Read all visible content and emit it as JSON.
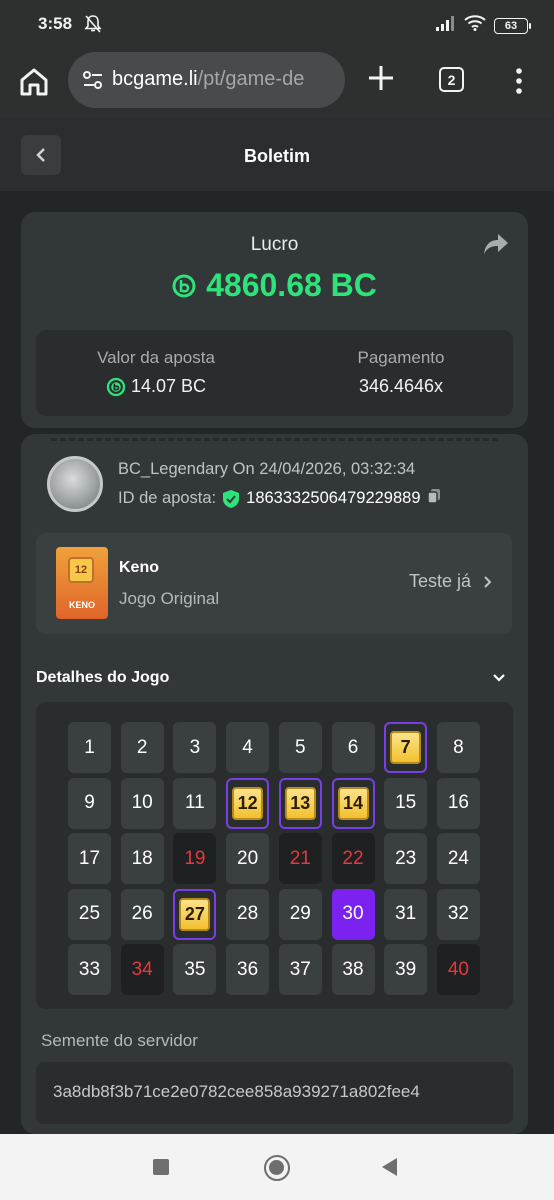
{
  "status_bar": {
    "time": "3:58",
    "battery": "63"
  },
  "browser": {
    "url_host": "bcgame.li",
    "url_path": "/pt/game-de",
    "tab_count": "2"
  },
  "header": {
    "title": "Boletim"
  },
  "profit": {
    "label": "Lucro",
    "value": "4860.68 BC",
    "bet_label": "Valor da aposta",
    "bet_value": "14.07 BC",
    "payout_label": "Pagamento",
    "payout_value": "346.4646x",
    "accent": "#2ee47a"
  },
  "bet": {
    "user_line": "BC_Legendary On 24/04/2026, 03:32:34",
    "id_label": "ID de aposta:",
    "id_value": "1863332506479229889"
  },
  "game": {
    "name": "Keno",
    "type": "Jogo Original",
    "try_label": "Teste já",
    "thumb_number": "12",
    "thumb_label": "KENO"
  },
  "details": {
    "title": "Detalhes do Jogo"
  },
  "grid": {
    "tiles": [
      {
        "n": "1",
        "s": "normal"
      },
      {
        "n": "2",
        "s": "normal"
      },
      {
        "n": "3",
        "s": "normal"
      },
      {
        "n": "4",
        "s": "normal"
      },
      {
        "n": "5",
        "s": "normal"
      },
      {
        "n": "6",
        "s": "normal"
      },
      {
        "n": "7",
        "s": "pick"
      },
      {
        "n": "8",
        "s": "normal"
      },
      {
        "n": "9",
        "s": "normal"
      },
      {
        "n": "10",
        "s": "normal"
      },
      {
        "n": "11",
        "s": "normal"
      },
      {
        "n": "12",
        "s": "pick"
      },
      {
        "n": "13",
        "s": "pick"
      },
      {
        "n": "14",
        "s": "pick"
      },
      {
        "n": "15",
        "s": "normal"
      },
      {
        "n": "16",
        "s": "normal"
      },
      {
        "n": "17",
        "s": "normal"
      },
      {
        "n": "18",
        "s": "normal"
      },
      {
        "n": "19",
        "s": "miss"
      },
      {
        "n": "20",
        "s": "normal"
      },
      {
        "n": "21",
        "s": "miss"
      },
      {
        "n": "22",
        "s": "miss"
      },
      {
        "n": "23",
        "s": "normal"
      },
      {
        "n": "24",
        "s": "normal"
      },
      {
        "n": "25",
        "s": "normal"
      },
      {
        "n": "26",
        "s": "normal"
      },
      {
        "n": "27",
        "s": "pick"
      },
      {
        "n": "28",
        "s": "normal"
      },
      {
        "n": "29",
        "s": "normal"
      },
      {
        "n": "30",
        "s": "draw"
      },
      {
        "n": "31",
        "s": "normal"
      },
      {
        "n": "32",
        "s": "normal"
      },
      {
        "n": "33",
        "s": "normal"
      },
      {
        "n": "34",
        "s": "miss"
      },
      {
        "n": "35",
        "s": "normal"
      },
      {
        "n": "36",
        "s": "normal"
      },
      {
        "n": "37",
        "s": "normal"
      },
      {
        "n": "38",
        "s": "normal"
      },
      {
        "n": "39",
        "s": "normal"
      },
      {
        "n": "40",
        "s": "miss"
      }
    ]
  },
  "seed": {
    "label": "Semente do servidor",
    "value": "3a8db8f3b71ce2e0782cee858a939271a802fee4"
  }
}
